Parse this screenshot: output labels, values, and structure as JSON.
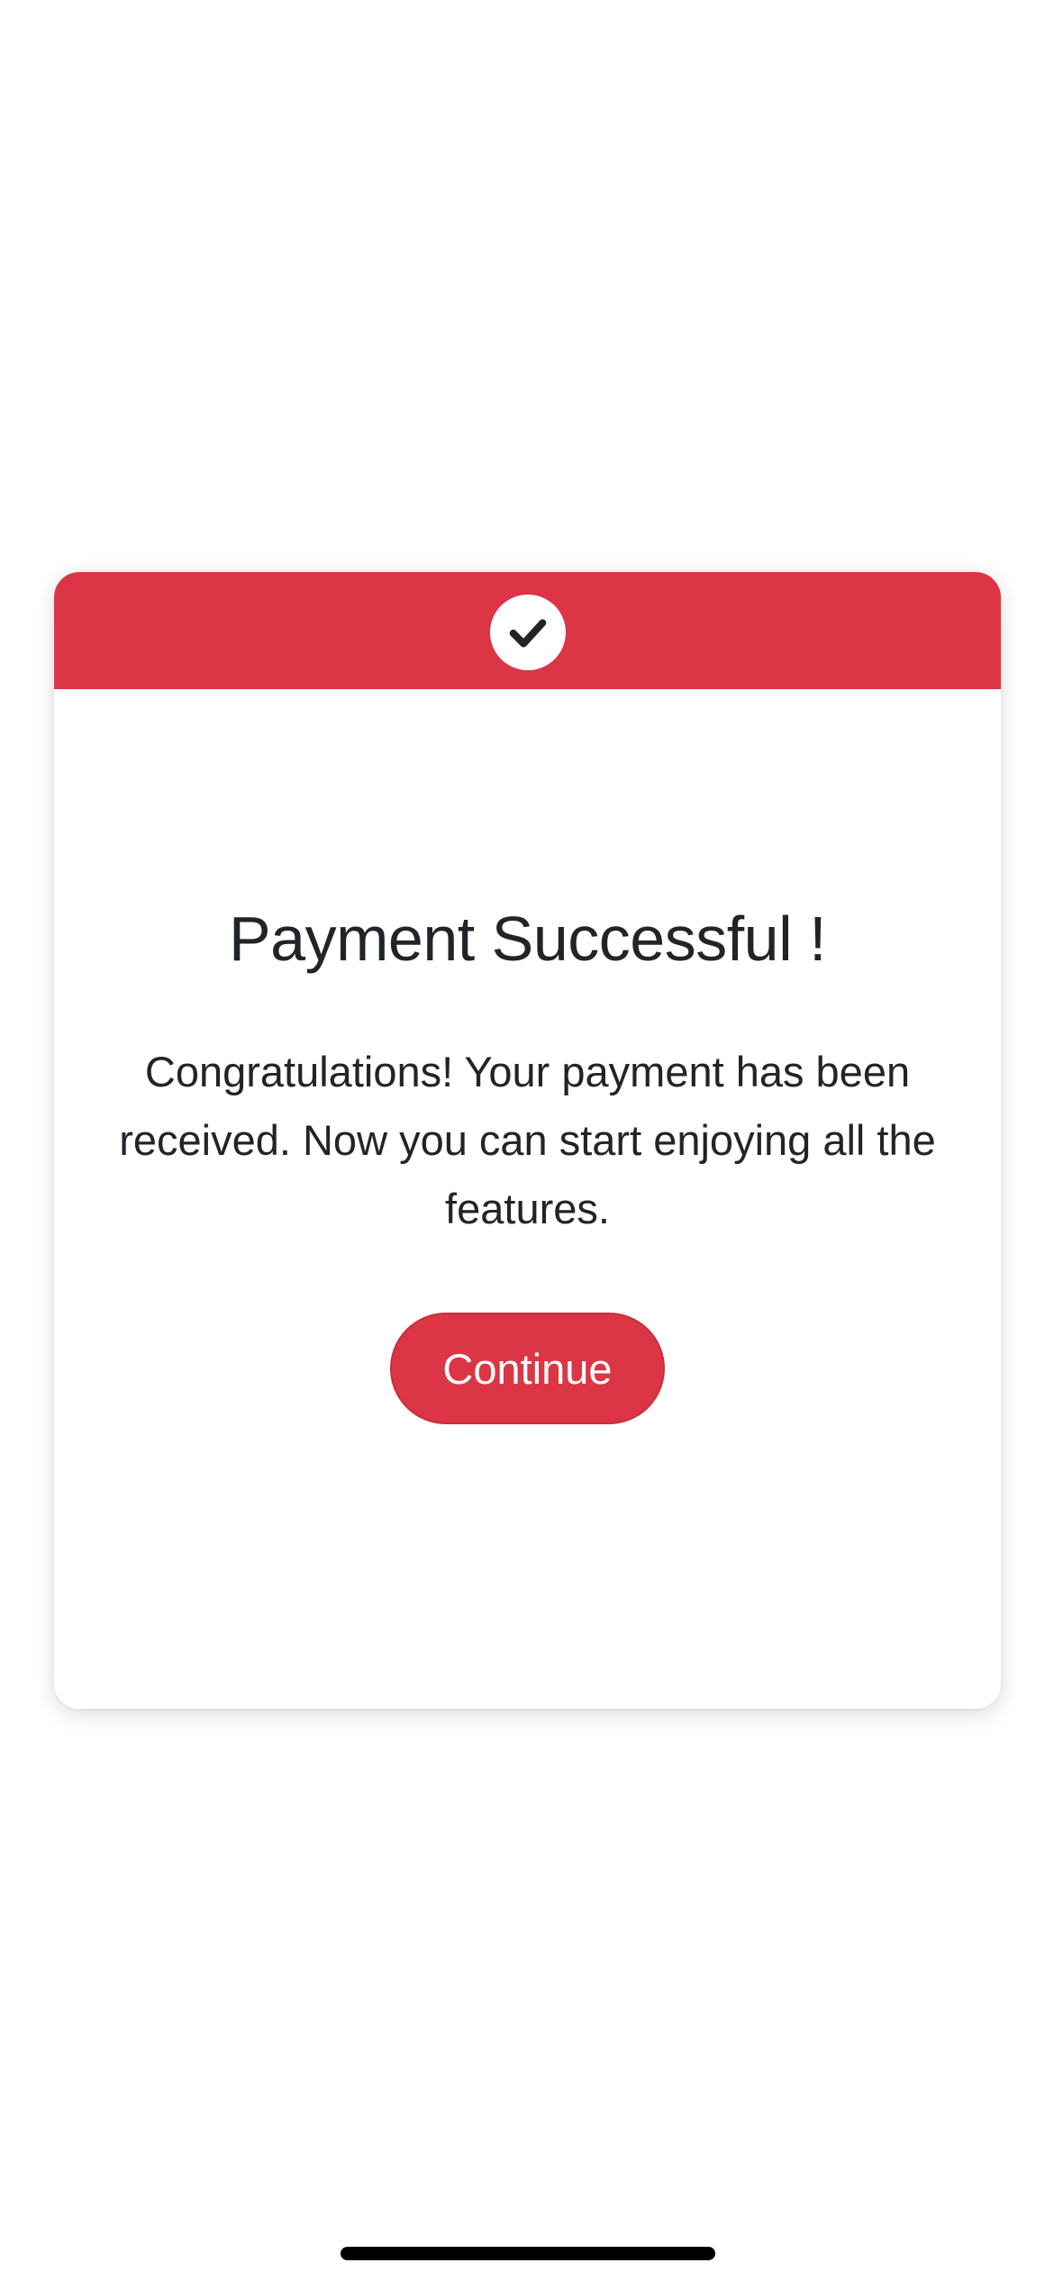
{
  "dialog": {
    "header_icon": "check-icon",
    "title": "Payment Successful !",
    "message": "Congratulations! Your payment has been received. Now you can start enjoying all the features.",
    "continue_label": "Continue"
  },
  "colors": {
    "accent": "#dc3545",
    "text": "#212529",
    "background": "#ffffff"
  }
}
